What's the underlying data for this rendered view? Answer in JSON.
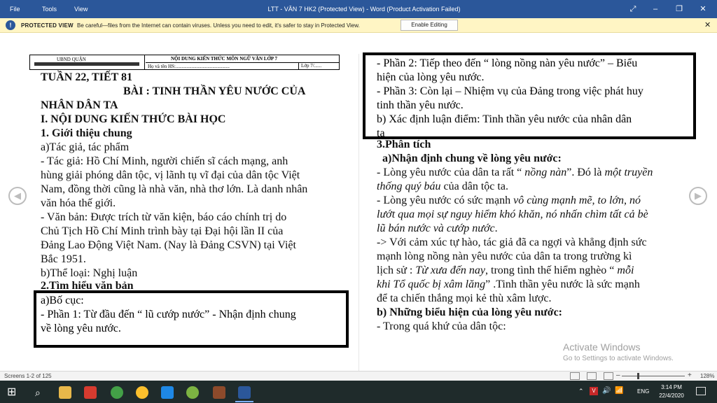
{
  "titlebar": {
    "menu": [
      "File",
      "Tools",
      "View"
    ],
    "title": "LTT - VĂN 7 HK2 (Protected View) - Word (Product Activation Failed)"
  },
  "protected_bar": {
    "label": "PROTECTED VIEW",
    "message": "Be careful—files from the Internet can contain viruses. Unless you need to edit, it's safer to stay in Protected View.",
    "button": "Enable Editing"
  },
  "header_table": {
    "left": "UBND QUẬN",
    "title": "NỘI DUNG KIẾN THỨC MÔN NGỮ VĂN LỚP 7",
    "name_field": "Họ và tên HS:............................................",
    "class_field": "Lớp 7/......"
  },
  "left_page": {
    "lines": [
      "TUẦN 22, TIẾT 81",
      "BÀI :    TINH THẦN YÊU NƯỚC CỦA",
      "NHÂN DÂN TA",
      "I. NỘI DUNG KIẾN THỨC BÀI HỌC",
      "1. Giới thiệu chung",
      "a)Tác giả, tác phẩm",
      "- Tác giả: Hồ Chí Minh, người chiến sĩ cách mạng, anh",
      "hùng giải phóng dân tộc, vị lãnh tụ vĩ đại của dân tộc Việt",
      "Nam, đồng thời cũng là nhà văn, nhà thơ lớn. Là danh nhân",
      "văn hóa thế giới.",
      "- Văn bản: Được trích từ văn kiện, báo cáo chính trị do",
      "Chủ Tịch Hồ Chí Minh trình bày tại Đại hội lần II của",
      "Đảng Lao Động Việt Nam. (Nay là Đảng CSVN) tại Việt",
      "Bắc 1951.",
      "b)Thể loại: Nghị luận",
      "2.Tìm hiểu văn bản",
      "a)Bố cục:",
      "-  Phần 1: Từ đầu đến “ lũ cướp nước” -  Nhận định chung",
      "về lòng yêu nước."
    ]
  },
  "right_page": {
    "lines": [
      "- Phần 2: Tiếp theo đến “ lòng nồng nàn yêu nước” – Biểu",
      "hiện của lòng yêu nước.",
      "- Phần 3: Còn lại – Nhiệm vụ của Đảng trong việc phát huy",
      "tinh thần yêu nước.",
      "b) Xác định luận điểm:  Tinh thần yêu nước của nhân dân",
      "ta",
      "3.Phân tích",
      "a)Nhận định chung về lòng yêu nước:",
      "- Lòng yêu nước của dân ta rất “ ",
      "nồng nàn",
      "”. Đó là ",
      "một truyền",
      "thống quý báu",
      " của dân tộc ta.",
      "- Lòng yêu nước có sức mạnh ",
      "vô cùng mạnh mẽ, to lớn, nó",
      "lướt qua mọi sự nguy hiểm khó khăn, nó nhấn chìm tất cả bè",
      "lũ          bán           nước           và           cướp           nước",
      ".",
      "-> Với cảm xúc tự hào, tác giả đã ca ngợi và khẳng định sức",
      "mạnh lòng nồng nàn yêu nước của dân ta trong trường kì",
      "lịch sử : ",
      "Từ xưa đến nay",
      ", trong tình thế hiểm nghèo “ ",
      "mỗi",
      "khi Tổ quốc bị xâm lăng",
      "” .Tinh thần yêu nước là sức mạnh",
      "để ta chiến thắng mọi kẻ thù xâm lược.",
      "b) Những biểu hiện của lòng yêu nước:",
      "- Trong quá khứ của dân tộc:"
    ]
  },
  "watermark": {
    "title": "Activate Windows",
    "sub": "Go to Settings to activate Windows."
  },
  "statusbar": {
    "pages": "Screens 1-2 of 125",
    "zoom": "128%"
  },
  "taskbar": {
    "time": "3:14 PM",
    "date": "22/4/2020",
    "lang": "ENG"
  },
  "colors": {
    "titlebar": "#2b579a",
    "protected_bar": "#fff5c4",
    "taskbar": "#1f2b2b"
  }
}
